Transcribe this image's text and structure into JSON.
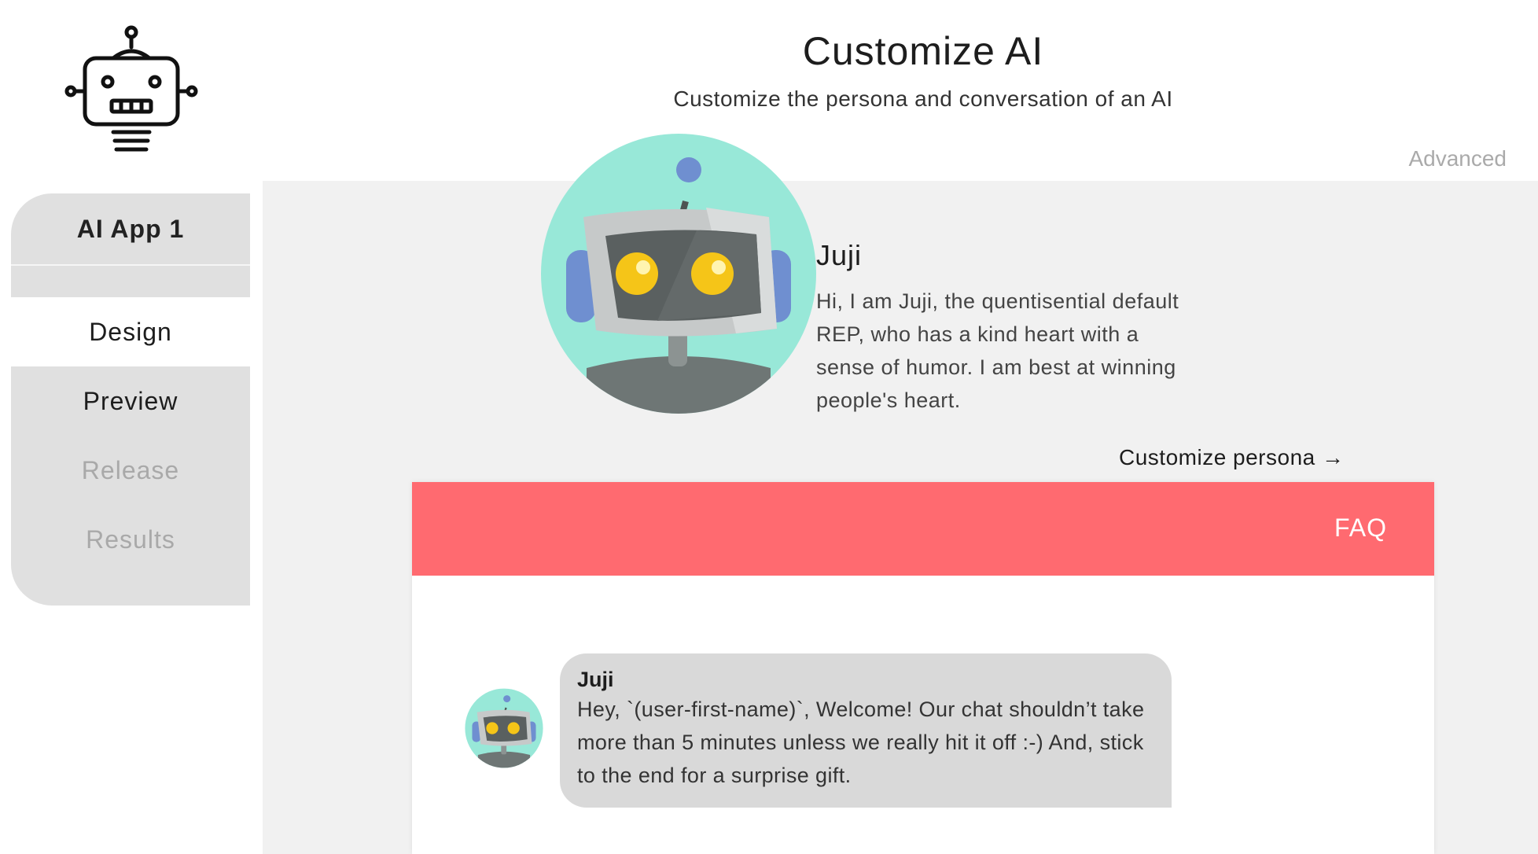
{
  "header": {
    "title": "Customize AI",
    "subtitle": "Customize the persona and conversation of an AI",
    "advanced_label": "Advanced"
  },
  "logo": {
    "icon": "robot-outline-icon"
  },
  "sidebar": {
    "app_name": "AI App 1",
    "items": [
      {
        "label": "Design",
        "state": "active"
      },
      {
        "label": "Preview",
        "state": "enabled"
      },
      {
        "label": "Release",
        "state": "disabled"
      },
      {
        "label": "Results",
        "state": "disabled"
      }
    ]
  },
  "persona": {
    "avatar_icon": "robot-avatar-icon",
    "name": "Juji",
    "description": "Hi, I am Juji, the quentisential default REP, who has a kind heart with a sense of humor. I am best at winning people's heart.",
    "customize_label": "Customize persona →"
  },
  "chat": {
    "faq_label": "FAQ",
    "message": {
      "sender": "Juji",
      "text": "Hey, `(user-first-name)`, Welcome! Our chat shouldn’t take more than 5 minutes unless we really hit it off :-) And, stick to the end for a surprise gift."
    }
  },
  "colors": {
    "accent_red": "#ff6a70",
    "avatar_teal": "#98e8d8",
    "panel_gray": "#f1f1f1",
    "sidebar_gray": "#e0e0e0",
    "disabled_text": "#a9a9a9"
  }
}
